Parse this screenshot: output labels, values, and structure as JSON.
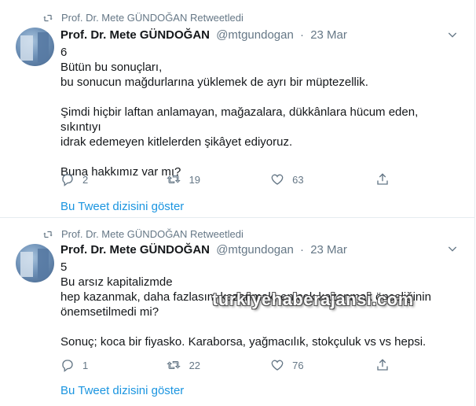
{
  "tweets": [
    {
      "retweet_label": "Prof. Dr. Mete GÜNDOĞAN Retweetledi",
      "name": "Prof. Dr. Mete GÜNDOĞAN",
      "handle": "@mtgundogan",
      "separator": "·",
      "date": "23 Mar",
      "lines": [
        "6",
        "Bütün bu sonuçları,",
        "bu sonucun mağdurlarına yüklemek de ayrı bir müptezellik.",
        "",
        "Şimdi hiçbir laftan anlamayan, mağazalara, dükkânlara hücum eden, sıkıntıyı",
        "idrak edemeyen kitlelerden şikâyet ediyoruz.",
        "",
        "Buna hakkımız var mı?"
      ],
      "replies": "2",
      "retweets": "19",
      "likes": "63",
      "show_thread": "Bu Tweet dizisini göster"
    },
    {
      "retweet_label": "Prof. Dr. Mete GÜNDOĞAN Retweetledi",
      "name": "Prof. Dr. Mete GÜNDOĞAN",
      "handle": "@mtgundogan",
      "separator": "·",
      "date": "23 Mar",
      "lines": [
        "5",
        "Bu arsız kapitalizmde",
        "hep kazanmak, daha fazlasını kazanmak, en çok kazanmak önceliğinin",
        "önemsetilmedi mi?",
        "",
        "Sonuç; koca bir fiyasko. Karaborsa, yağmacılık, stokçuluk vs vs hepsi."
      ],
      "replies": "1",
      "retweets": "22",
      "likes": "76",
      "show_thread": "Bu Tweet dizisini göster"
    }
  ],
  "watermark": "turkiyehaberajansi.com",
  "colors": {
    "accent": "#1b95e0",
    "muted": "#657786",
    "text": "#14171a",
    "divider": "#e6ecf0"
  },
  "icons": [
    "retweet-icon",
    "reply-icon",
    "like-icon",
    "share-icon",
    "chevron-down-icon"
  ]
}
